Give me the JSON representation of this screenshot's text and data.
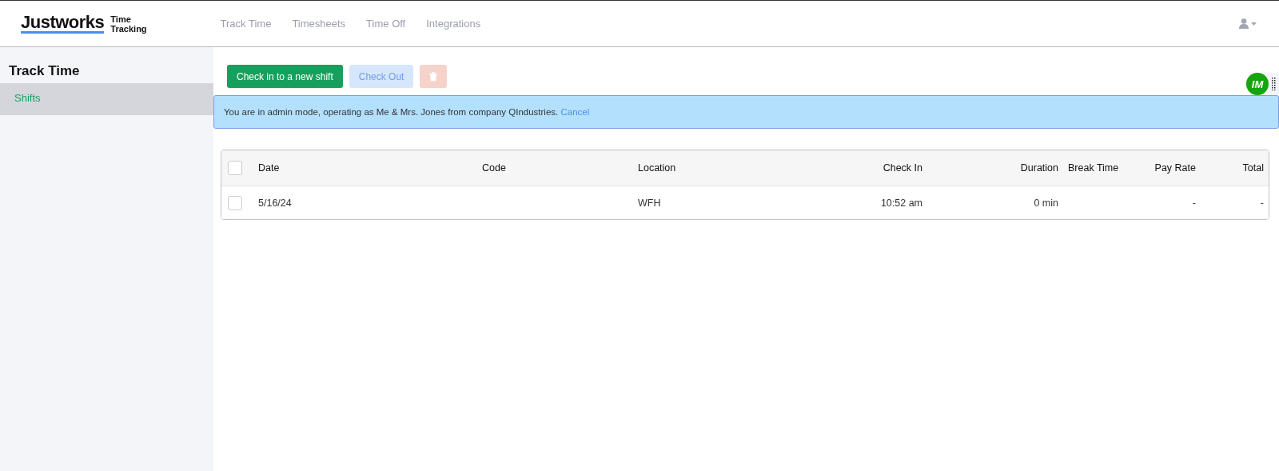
{
  "header": {
    "logo": "Justworks",
    "product": [
      "Time",
      "Tracking"
    ],
    "nav": [
      {
        "label": "Track Time"
      },
      {
        "label": "Timesheets"
      },
      {
        "label": "Time Off"
      },
      {
        "label": "Integrations"
      }
    ]
  },
  "sidebar": {
    "title": "Track Time",
    "items": [
      {
        "label": "Shifts",
        "selected": true
      }
    ]
  },
  "toolbar": {
    "buttons": [
      {
        "kind": "primary",
        "label": "Check in to a new shift",
        "disabled": false
      },
      {
        "kind": "secondary",
        "label": "Check Out",
        "disabled": true
      },
      {
        "kind": "delete",
        "disabled": true
      }
    ]
  },
  "banner": {
    "text": "You are in admin mode, operating as Me & Mrs. Jones from company QIndustries.",
    "link": "Cancel"
  },
  "widget": {
    "initials": "IM"
  },
  "table": {
    "header_checked": false,
    "columns": [
      {
        "label": "Date"
      },
      {
        "label": "Code"
      },
      {
        "label": "Location"
      },
      {
        "label": "Check In"
      },
      {
        "label": "Duration"
      },
      {
        "label": "Break Time"
      },
      {
        "label": "Pay Rate"
      },
      {
        "label": "Total"
      }
    ],
    "rows": [
      {
        "checked": false,
        "cells": [
          "5/16/24",
          "",
          "WFH",
          "10:52 am",
          "0 min",
          "",
          "-",
          "-"
        ]
      }
    ]
  }
}
